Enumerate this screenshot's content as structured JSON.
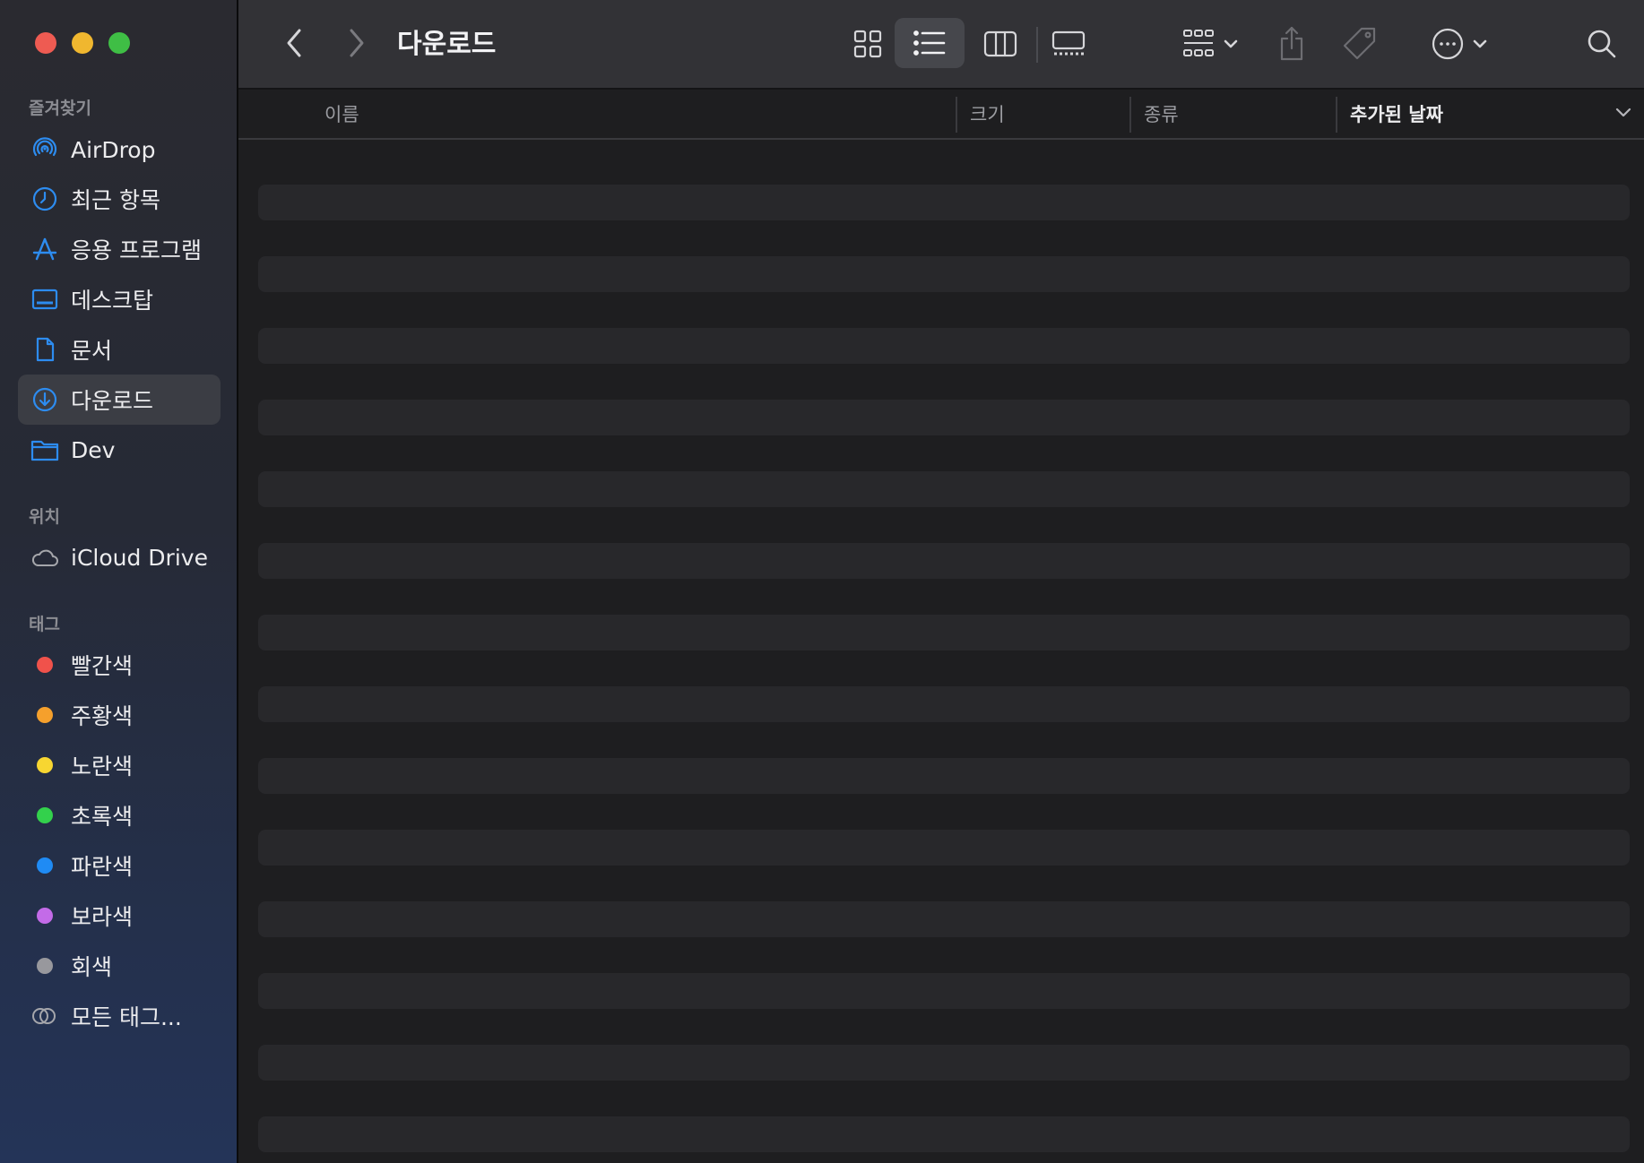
{
  "window": {
    "title": "다운로드"
  },
  "sidebar": {
    "favorites_label": "즐겨찾기",
    "favorites": [
      {
        "label": "AirDrop",
        "icon": "airdrop-icon"
      },
      {
        "label": "최근 항목",
        "icon": "clock-icon"
      },
      {
        "label": "응용 프로그램",
        "icon": "applications-icon"
      },
      {
        "label": "데스크탑",
        "icon": "desktop-icon"
      },
      {
        "label": "문서",
        "icon": "document-icon"
      },
      {
        "label": "다운로드",
        "icon": "download-icon",
        "selected": true
      },
      {
        "label": "Dev",
        "icon": "folder-icon"
      }
    ],
    "locations_label": "위치",
    "locations": [
      {
        "label": "iCloud Drive",
        "icon": "cloud-icon"
      }
    ],
    "tags_label": "태그",
    "tags": [
      {
        "label": "빨간색",
        "color": "#f0524b"
      },
      {
        "label": "주황색",
        "color": "#f5a02c"
      },
      {
        "label": "노란색",
        "color": "#f7d631"
      },
      {
        "label": "초록색",
        "color": "#33d14c"
      },
      {
        "label": "파란색",
        "color": "#1f8bf4"
      },
      {
        "label": "보라색",
        "color": "#c36be8"
      },
      {
        "label": "회색",
        "color": "#98989d"
      }
    ],
    "all_tags_label": "모든 태그..."
  },
  "toolbar": {
    "view_mode_selected": "list",
    "icons": [
      "back-icon",
      "forward-icon",
      "icon-view-icon",
      "list-view-icon",
      "column-view-icon",
      "gallery-view-icon",
      "group-icon",
      "share-icon",
      "tag-icon",
      "more-icon",
      "search-icon"
    ]
  },
  "columns": {
    "name": "이름",
    "size": "크기",
    "kind": "종류",
    "date_added": "추가된 날짜"
  },
  "colors": {
    "accent": "#2d8cf0",
    "selection": "#3b3d44"
  }
}
